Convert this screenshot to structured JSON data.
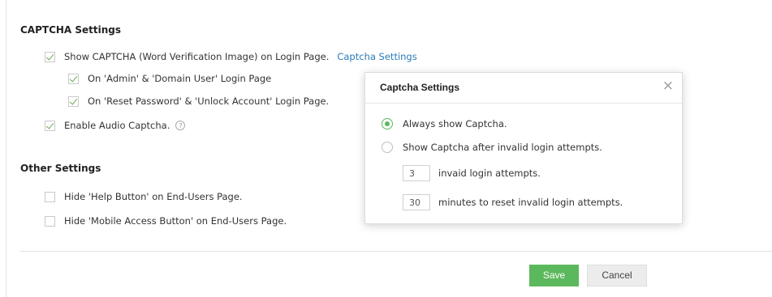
{
  "captcha": {
    "title": "CAPTCHA Settings",
    "show_captcha_label": "Show CAPTCHA (Word Verification Image) on Login Page.",
    "settings_link": "Captcha Settings",
    "admin_domain_label": "On 'Admin' & 'Domain User' Login Page",
    "reset_unlock_label": "On 'Reset Password' & 'Unlock Account' Login Page.",
    "audio_label": "Enable Audio Captcha.",
    "help_glyph": "?"
  },
  "other": {
    "title": "Other Settings",
    "hide_help_label": "Hide 'Help Button' on End-Users Page.",
    "hide_mobile_label": "Hide 'Mobile Access Button' on End-Users Page."
  },
  "buttons": {
    "save": "Save",
    "cancel": "Cancel"
  },
  "popup": {
    "title": "Captcha Settings",
    "close_glyph": "×",
    "always_label": "Always show Captcha.",
    "after_invalid_label": "Show Captcha after invalid login attempts.",
    "attempts_value": "3",
    "attempts_label": "invaid login attempts.",
    "minutes_value": "30",
    "minutes_label": "minutes to reset invalid login attempts.",
    "selected_option": "always"
  },
  "colors": {
    "accent_green": "#5cb85c",
    "link_blue": "#2a7ab8"
  }
}
